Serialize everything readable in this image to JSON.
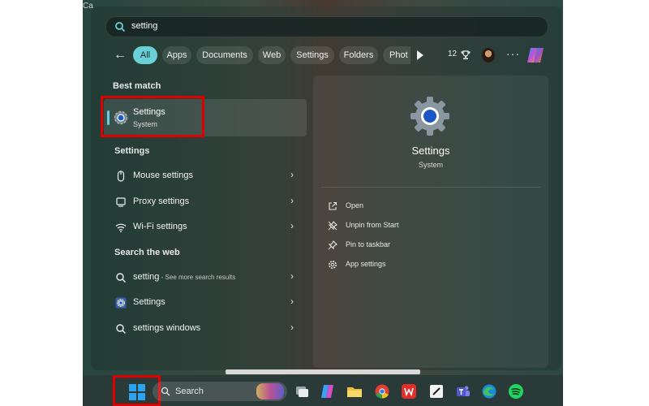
{
  "corner_text": "Ca",
  "search": {
    "query": "setting"
  },
  "filters": {
    "tabs": [
      {
        "label": "All",
        "active": true
      },
      {
        "label": "Apps"
      },
      {
        "label": "Documents"
      },
      {
        "label": "Web"
      },
      {
        "label": "Settings"
      },
      {
        "label": "Folders"
      },
      {
        "label": "Phot"
      }
    ],
    "rewards_points": "12"
  },
  "best_match": {
    "heading": "Best match",
    "item": {
      "title": "Settings",
      "subtitle": "System",
      "icon": "gear-icon"
    }
  },
  "settings_section": {
    "heading": "Settings",
    "items": [
      {
        "label": "Mouse settings",
        "icon": "mouse-icon"
      },
      {
        "label": "Proxy settings",
        "icon": "proxy-icon"
      },
      {
        "label": "Wi-Fi settings",
        "icon": "wifi-icon"
      }
    ]
  },
  "web_section": {
    "heading": "Search the web",
    "items": [
      {
        "label": "setting",
        "suffix": " - See more search results",
        "icon": "search-icon"
      },
      {
        "label": "Settings",
        "icon": "gear-icon"
      },
      {
        "label": "settings windows",
        "icon": "search-icon"
      }
    ]
  },
  "details": {
    "title": "Settings",
    "subtitle": "System",
    "actions": [
      {
        "label": "Open",
        "icon": "open-icon"
      },
      {
        "label": "Unpin from Start",
        "icon": "unpin-icon"
      },
      {
        "label": "Pin to taskbar",
        "icon": "pin-icon"
      },
      {
        "label": "App settings",
        "icon": "gear-icon"
      }
    ]
  },
  "taskbar": {
    "search_label": "Search",
    "icons": [
      "task-view-icon",
      "copilot-icon",
      "file-explorer-icon",
      "chrome-icon",
      "wps-office-icon",
      "notes-icon",
      "teams-icon",
      "edge-icon",
      "spotify-icon"
    ]
  },
  "colors": {
    "accent": "#6ad0d8",
    "highlight": "#e00000"
  }
}
